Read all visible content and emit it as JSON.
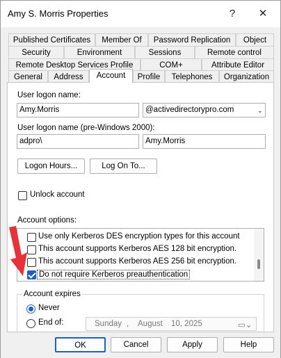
{
  "window": {
    "title": "Amy S. Morris Properties",
    "help_label": "?",
    "close_label": "✕"
  },
  "tabs": {
    "row1": [
      "Published Certificates",
      "Member Of",
      "Password Replication",
      "Object"
    ],
    "row2": [
      "Security",
      "Environment",
      "Sessions",
      "Remote control"
    ],
    "row3": [
      "Remote Desktop Services Profile",
      "COM+",
      "Attribute Editor"
    ],
    "row4": [
      "General",
      "Address",
      "Account",
      "Profile",
      "Telephones",
      "Organization"
    ],
    "active": "Account"
  },
  "account": {
    "logon_name_label": "User logon name:",
    "logon_name_value": "Amy.Morris",
    "domain_value": "@activedirectorypro.com",
    "pre2000_label": "User logon name (pre-Windows 2000):",
    "pre2000_domain": "adpro\\",
    "pre2000_name": "Amy.Morris",
    "logon_hours_button": "Logon Hours...",
    "log_on_to_button": "Log On To...",
    "unlock_label": "Unlock account",
    "unlock_checked": false,
    "options_label": "Account options:",
    "options": [
      {
        "label": "Use only Kerberos DES encryption types for this account",
        "checked": false
      },
      {
        "label": "This account supports Kerberos AES 128 bit encryption.",
        "checked": false
      },
      {
        "label": "This account supports Kerberos AES 256 bit encryption.",
        "checked": false
      },
      {
        "label": "Do not require Kerberos preauthentication",
        "checked": true
      }
    ]
  },
  "expires": {
    "group_label": "Account expires",
    "never_label": "Never",
    "never_selected": true,
    "endof_label": "End of:",
    "date_day": "Sunday",
    "date_sep": ",",
    "date_month": "August",
    "date_rest": "10, 2025"
  },
  "footer": {
    "ok": "OK",
    "cancel": "Cancel",
    "apply": "Apply",
    "help": "Help"
  },
  "colors": {
    "accent": "#1f5fbf",
    "annotation_arrow": "#e8323a"
  },
  "icons": [
    "help-icon",
    "close-icon",
    "dropdown-arrow-icon",
    "calendar-icon",
    "annotation-arrow"
  ]
}
